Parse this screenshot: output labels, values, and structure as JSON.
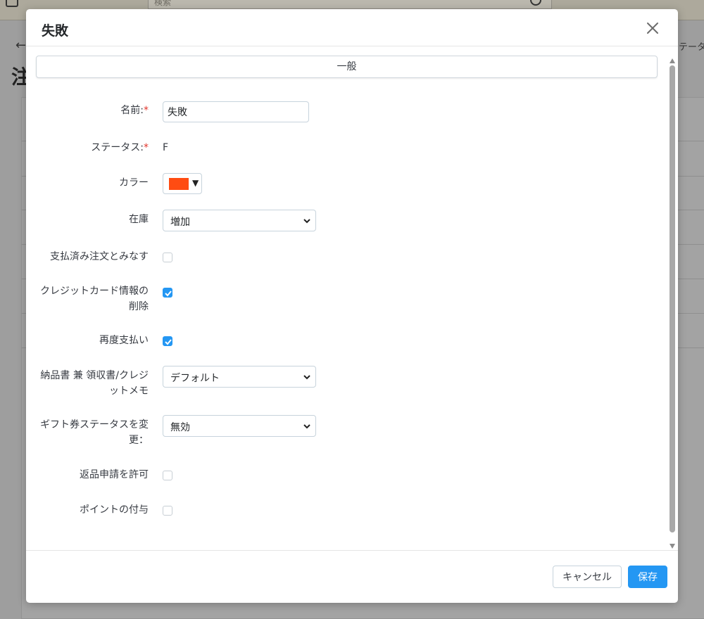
{
  "background": {
    "search_placeholder": "検索",
    "page_title": "注",
    "right_text": "テータ"
  },
  "modal": {
    "title": "失敗",
    "tab": {
      "label": "一般"
    },
    "fields": {
      "name": {
        "label": "名前:",
        "required_mark": "*",
        "value": "失敗"
      },
      "status": {
        "label": "ステータス:",
        "required_mark": "*",
        "value": "F"
      },
      "color": {
        "label": "カラー",
        "value": "#ff4c12"
      },
      "stock": {
        "label": "在庫",
        "selected": "増加"
      },
      "paid": {
        "label": "支払済み注文とみなす",
        "checked": false
      },
      "cc_delete": {
        "label_line1": "クレジットカード情報の",
        "label_line2": "削除",
        "checked": true
      },
      "repay": {
        "label": "再度支払い",
        "checked": true
      },
      "invoice": {
        "label_line1": "納品書 兼 領収書/クレジ",
        "label_line2": "ットメモ",
        "selected": "デフォルト"
      },
      "gift": {
        "label_line1": "ギフト券ステータスを変",
        "label_line2": "更：",
        "selected": "無効"
      },
      "returns": {
        "label": "返品申請を許可",
        "checked": false
      },
      "points": {
        "label": "ポイントの付与",
        "checked": false
      }
    },
    "footer": {
      "cancel_label": "キャンセル",
      "save_label": "保存"
    }
  },
  "colors": {
    "accent": "#2497f3",
    "required": "#e2362c",
    "swatch": "#ff4c12"
  },
  "icons": {
    "close": "close-icon",
    "checkmark": "checkmark-icon",
    "chevron": "chevron-down-icon"
  }
}
